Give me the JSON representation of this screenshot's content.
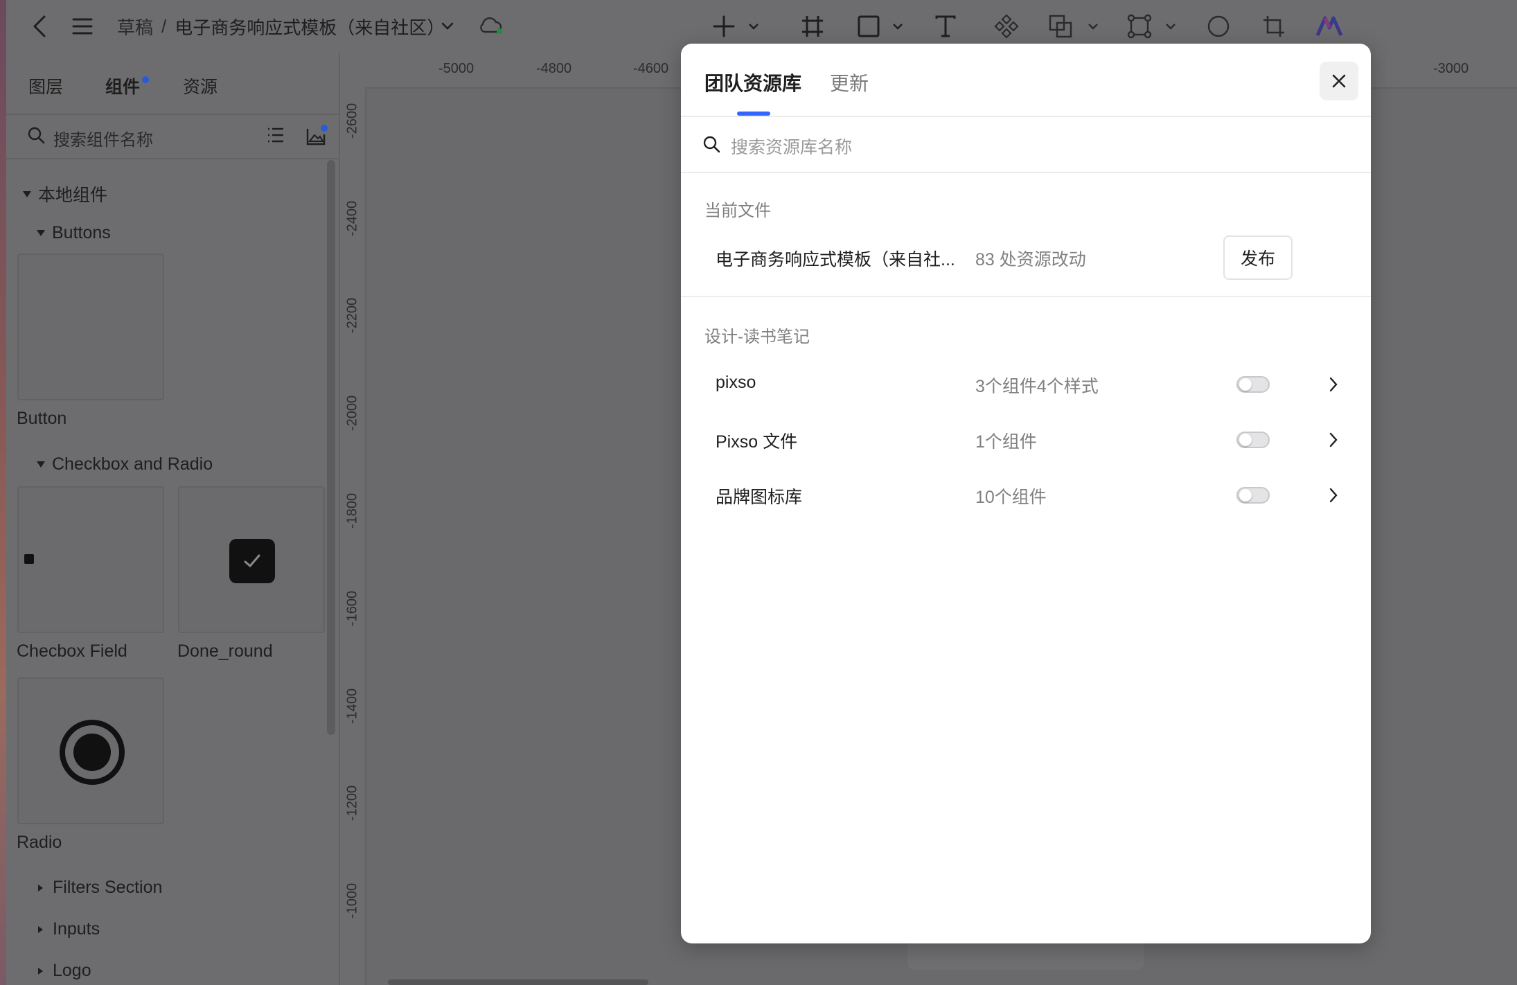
{
  "topbar": {
    "breadcrumb_draft": "草稿",
    "breadcrumb_sep": "/",
    "file_title": "电子商务响应式模板（来自社区）",
    "icons": [
      "back-icon",
      "menu-icon",
      "chevron-down-icon",
      "cloud-sync-icon",
      "add-icon",
      "frame-icon",
      "rectangle-icon",
      "text-icon",
      "component-icon",
      "boolean-icon",
      "multi-component-icon",
      "ellipse-icon",
      "crop-icon",
      "ai-logo-icon"
    ]
  },
  "left_panel": {
    "tabs": [
      {
        "label": "图层"
      },
      {
        "label": "组件"
      },
      {
        "label": "资源"
      }
    ],
    "search_placeholder": "搜索组件名称",
    "local_components": "本地组件",
    "groups": {
      "buttons": "Buttons",
      "checkbox_radio": "Checkbox and Radio",
      "filters": "Filters Section",
      "inputs": "Inputs",
      "logo": "Logo"
    },
    "components": {
      "button": "Button",
      "checkbox_field": "Checbox Field",
      "done_round": "Done_round",
      "radio": "Radio"
    }
  },
  "rulers": {
    "top": [
      "-5000",
      "-4800",
      "-4600",
      "-3000"
    ],
    "left": [
      "-2600",
      "-2400",
      "-2200",
      "-2000",
      "-1800",
      "-1600",
      "-1400",
      "-1200",
      "-1000"
    ]
  },
  "modal": {
    "tabs": [
      "团队资源库",
      "更新"
    ],
    "search_placeholder": "搜索资源库名称",
    "current_file_title": "当前文件",
    "current_file": {
      "name": "电子商务响应式模板（来自社...",
      "changes": "83 处资源改动",
      "publish_label": "发布"
    },
    "team_title": "设计-读书笔记",
    "libraries": [
      {
        "name": "pixso",
        "meta": "3个组件4个样式",
        "enabled": false
      },
      {
        "name": "Pixso 文件",
        "meta": "1个组件",
        "enabled": false
      },
      {
        "name": "品牌图标库",
        "meta": "10个组件",
        "enabled": false
      }
    ]
  },
  "colors": {
    "accent": "#3366ff",
    "notification_dot": "#2a5bd7",
    "overlay_bg": "#6a6a6c"
  }
}
